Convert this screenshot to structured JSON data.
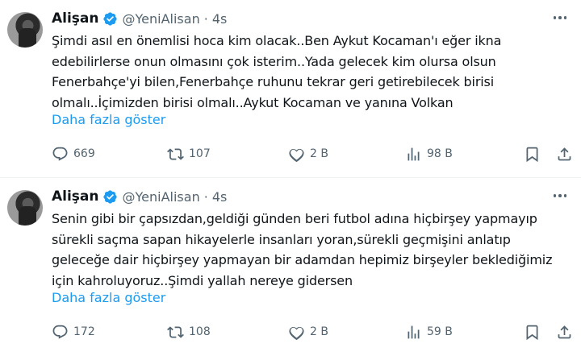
{
  "tweets": [
    {
      "name": "Alişan",
      "handle": "@YeniAlisan",
      "separator": "·",
      "time": "4s",
      "text": "Şimdi asıl en önemlisi hoca kim olacak..Ben Aykut Kocaman'ı eğer ikna edebilirlerse onun olmasını çok isterim..Yada gelecek kim olursa olsun Fenerbahçe'yi bilen,Fenerbahçe ruhunu tekrar geri getirebilecek birisi olmalı..İçimizden birisi olmalı..Aykut Kocaman ve yanına Volkan",
      "show_more": "Daha fazla göster",
      "replies": "669",
      "reposts": "107",
      "likes": "2 B",
      "views": "98 B"
    },
    {
      "name": "Alişan",
      "handle": "@YeniAlisan",
      "separator": "·",
      "time": "4s",
      "text": "Senin gibi bir çapsızdan,geldiği günden beri futbol adına hiçbirşey yapmayıp sürekli saçma sapan hikayelerle insanları yoran,sürekli geçmişini anlatıp geleceğe dair hiçbirşey yapmayan bir adamdan hepimiz birşeyler beklediğimiz için kahroluyoruz..Şimdi yallah nereye gidersen",
      "show_more": "Daha fazla göster",
      "replies": "172",
      "reposts": "108",
      "likes": "2 B",
      "views": "59 B"
    }
  ],
  "colors": {
    "text": "#0f1419",
    "muted": "#536471",
    "link": "#1d9bf0",
    "verified": "#1d9bf0",
    "divider": "#eff3f4"
  },
  "icons": [
    "more-icon",
    "verified-badge-icon",
    "reply-icon",
    "repost-icon",
    "like-icon",
    "views-icon",
    "bookmark-icon",
    "share-icon"
  ]
}
